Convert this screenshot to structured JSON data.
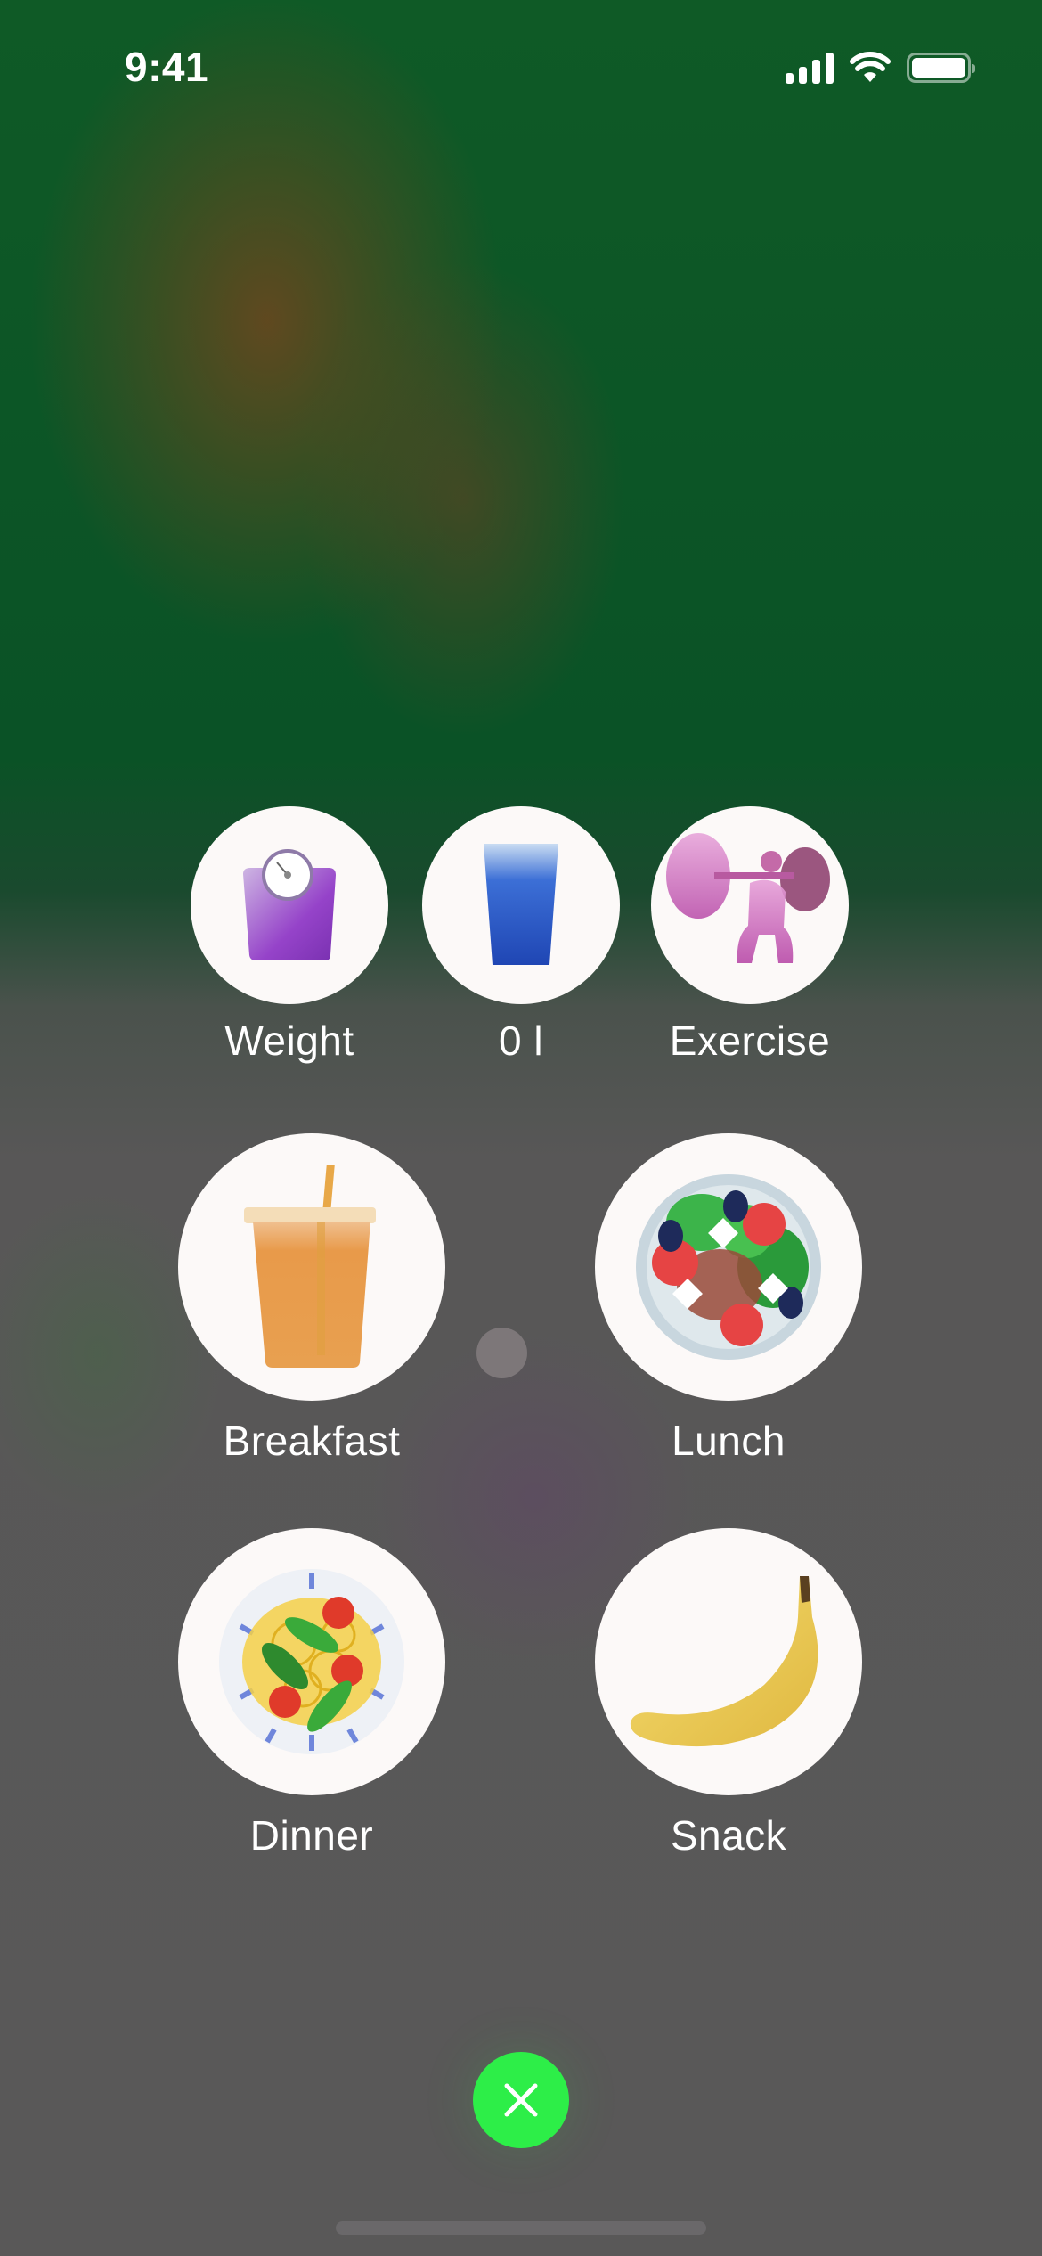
{
  "status_bar": {
    "time": "9:41",
    "icons": [
      "cellular-signal-icon",
      "wifi-icon",
      "battery-icon"
    ]
  },
  "quick_actions": [
    {
      "id": "weight",
      "label": "Weight",
      "icon": "bathroom-scale-icon"
    },
    {
      "id": "water",
      "label": "0 l",
      "icon": "water-glass-icon"
    },
    {
      "id": "exercise",
      "label": "Exercise",
      "icon": "weightlifter-icon"
    }
  ],
  "meals": [
    {
      "id": "breakfast",
      "label": "Breakfast",
      "icon": "iced-drink-icon"
    },
    {
      "id": "lunch",
      "label": "Lunch",
      "icon": "salad-bowl-icon"
    },
    {
      "id": "dinner",
      "label": "Dinner",
      "icon": "pasta-plate-icon"
    },
    {
      "id": "snack",
      "label": "Snack",
      "icon": "banana-icon"
    }
  ],
  "close_button": {
    "icon": "close-icon"
  },
  "colors": {
    "accent_green": "#2dee48",
    "circle_bg": "#fcf9f8",
    "overlay_bg": "#595757"
  }
}
